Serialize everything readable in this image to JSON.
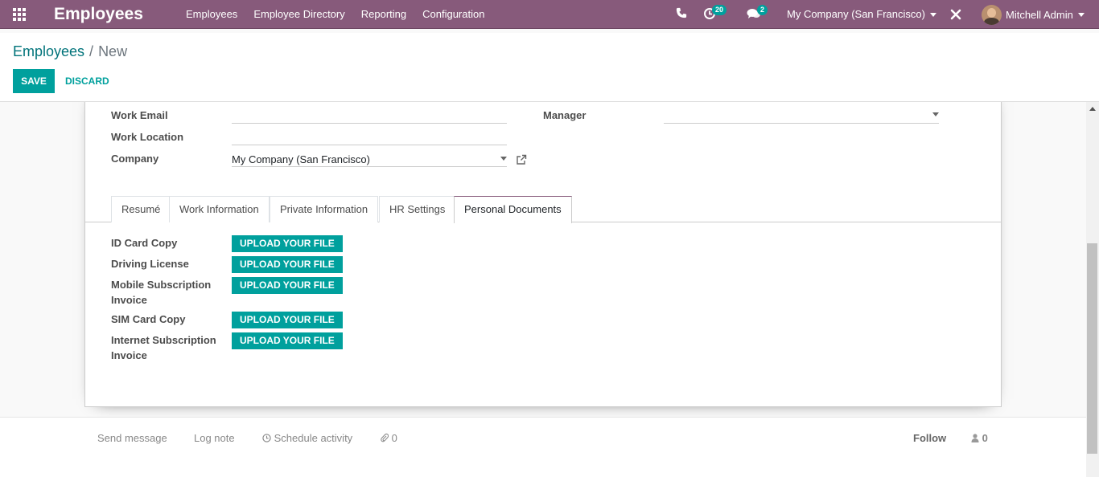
{
  "navbar": {
    "brand": "Employees",
    "menu": [
      "Employees",
      "Employee Directory",
      "Reporting",
      "Configuration"
    ],
    "activity_count": "20",
    "message_count": "2",
    "company": "My Company (San Francisco)",
    "user": "Mitchell Admin",
    "icons": [
      "apps-grid-icon",
      "phone-icon",
      "activity-clock-icon",
      "chat-bubbles-icon",
      "tools-cross-icon",
      "user-avatar"
    ]
  },
  "breadcrumb": {
    "parent": "Employees",
    "separator": "/",
    "current": "New"
  },
  "buttons": {
    "save": "Save",
    "discard": "Discard"
  },
  "form": {
    "work_email_label": "Work Email",
    "work_email_value": "",
    "work_location_label": "Work Location",
    "work_location_value": "",
    "company_label": "Company",
    "company_value": "My Company (San Francisco)",
    "manager_label": "Manager",
    "manager_value": ""
  },
  "tabs": [
    {
      "label": "Resumé",
      "active": false
    },
    {
      "label": "Work Information",
      "active": false
    },
    {
      "label": "Private Information",
      "active": false
    },
    {
      "label": "HR Settings",
      "active": false
    },
    {
      "label": "Personal Documents",
      "active": true
    }
  ],
  "documents": [
    {
      "label_line1": "ID Card Copy",
      "label_line2": "",
      "button": "Upload your file"
    },
    {
      "label_line1": "Driving License",
      "label_line2": "",
      "button": "Upload your file"
    },
    {
      "label_line1": "Mobile Subscription",
      "label_line2": "Invoice",
      "button": "Upload your file"
    },
    {
      "label_line1": "SIM Card Copy",
      "label_line2": "",
      "button": "Upload your file"
    },
    {
      "label_line1": "Internet Subscription",
      "label_line2": "Invoice",
      "button": "Upload your file"
    }
  ],
  "chatter": {
    "send_message": "Send message",
    "log_note": "Log note",
    "schedule_activity": "Schedule activity",
    "attachments_count": "0",
    "follow": "Follow",
    "followers_count": "0"
  },
  "colors": {
    "navbar": "#875a7b",
    "primary": "#00a09d",
    "link": "#00737a"
  }
}
